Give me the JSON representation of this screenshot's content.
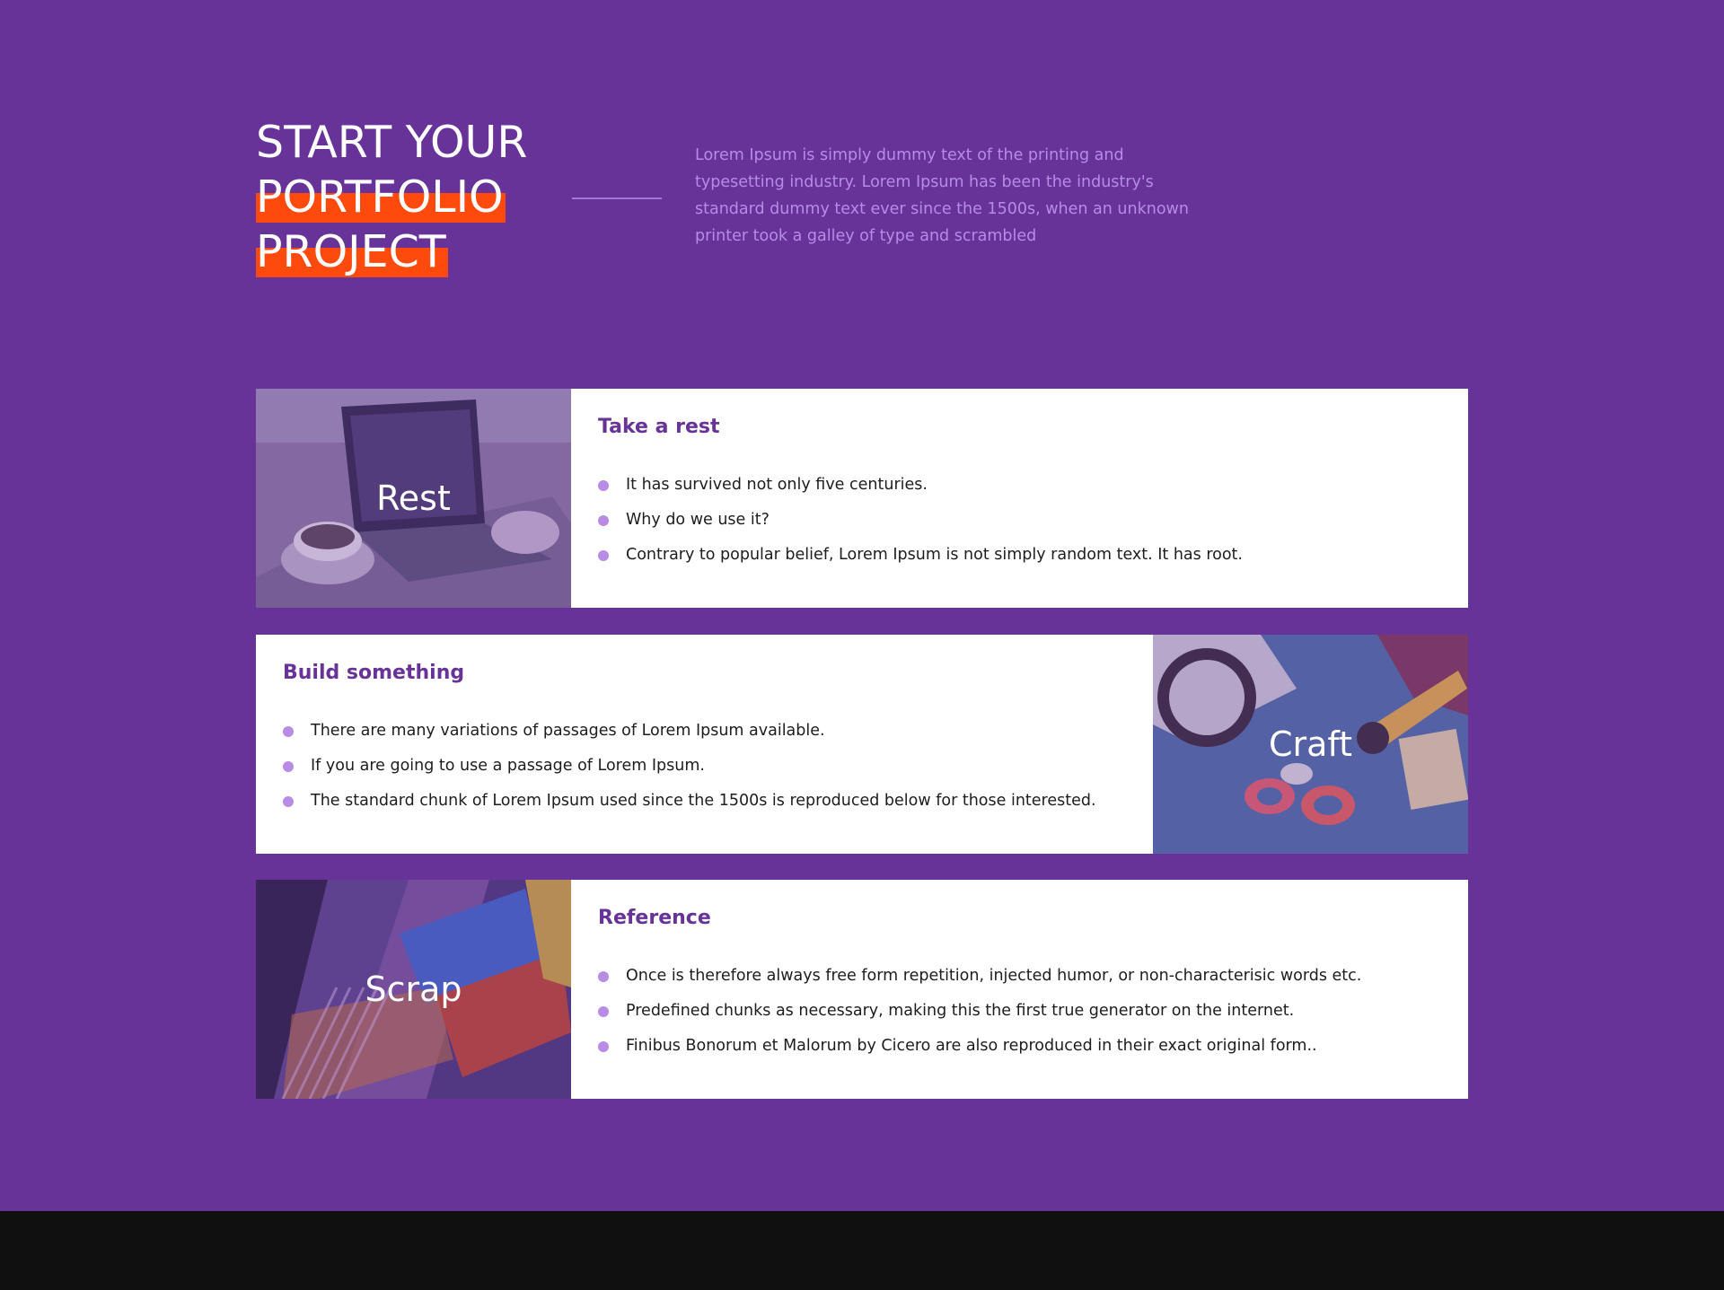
{
  "hero": {
    "title_line1": "START YOUR",
    "title_line2": "PORTFOLIO",
    "title_line3": "PROJECT",
    "description": "Lorem Ipsum is simply dummy text of the printing and typesetting industry. Lorem Ipsum has been the industry's standard dummy text ever since the 1500s, when an unknown printer took a galley of type and scrambled"
  },
  "cards": [
    {
      "image_label": "Rest",
      "title": "Take a rest",
      "items": [
        "It has survived not only five centuries.",
        "Why do we use it?",
        "Contrary to popular belief, Lorem Ipsum is not simply random text. It has root."
      ]
    },
    {
      "image_label": "Craft",
      "title": "Build something",
      "items": [
        "There are many variations of passages of Lorem Ipsum available.",
        "If you are going to use a passage of Lorem Ipsum.",
        "The standard chunk of Lorem Ipsum used since the 1500s is reproduced below for those interested."
      ]
    },
    {
      "image_label": "Scrap",
      "title": "Reference",
      "items": [
        "Once is therefore always free form repetition, injected humor, or non-characterisic words etc.",
        "Predefined chunks as necessary, making this the first true generator on the internet.",
        "Finibus Bonorum et Malorum by Cicero are also reproduced in their exact original form.."
      ]
    }
  ],
  "colors": {
    "background": "#673399",
    "highlight": "#ff4a0d",
    "accent_text": "#b78be6",
    "card_title": "#673399",
    "footer": "#101010"
  }
}
